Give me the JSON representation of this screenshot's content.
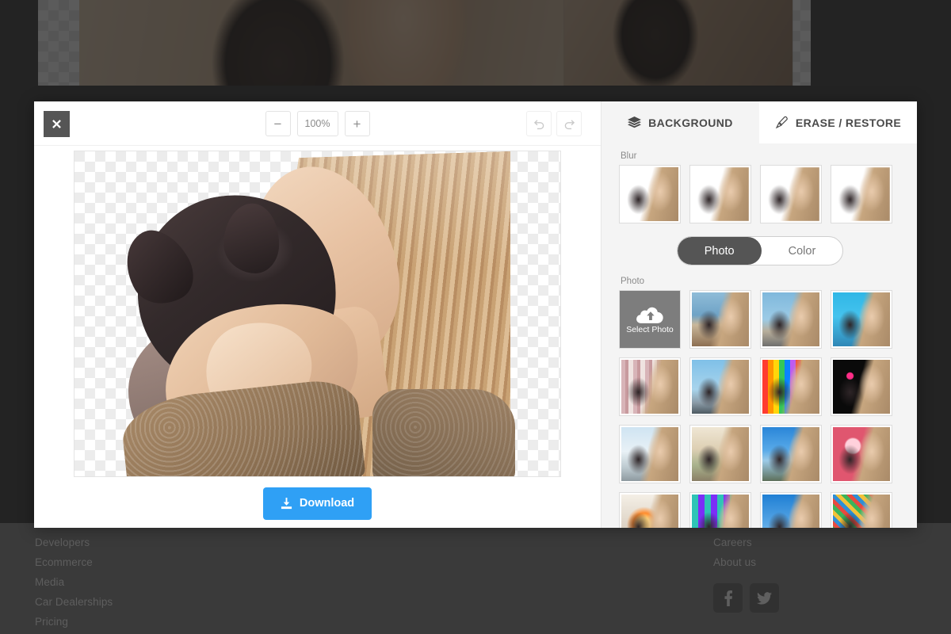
{
  "background_page": {
    "footer": {
      "left_links": [
        "Developers",
        "Ecommerce",
        "Media",
        "Car Dealerships",
        "Pricing"
      ],
      "right_links": [
        "Careers",
        "About us"
      ],
      "social": [
        {
          "name": "facebook-icon",
          "label": "Facebook"
        },
        {
          "name": "twitter-icon",
          "label": "Twitter"
        }
      ]
    }
  },
  "modal": {
    "toolbar": {
      "close_label": "✕",
      "zoom_out_label": "−",
      "zoom_value": "100%",
      "zoom_in_label": "+",
      "undo_label": "Undo",
      "redo_label": "Redo"
    },
    "canvas": {
      "transparency": "checkerboard",
      "alt": "Woman kissing a French bulldog puppy, background removed"
    },
    "download": {
      "label": "Download",
      "color": "#2fa0f5",
      "icon": "download-icon"
    }
  },
  "panel": {
    "tabs": [
      {
        "id": "background",
        "label": "BACKGROUND",
        "icon": "layers-icon",
        "active": false
      },
      {
        "id": "erase-restore",
        "label": "ERASE / RESTORE",
        "icon": "brush-icon",
        "active": true
      }
    ],
    "blur": {
      "label": "Blur",
      "items": [
        {
          "id": "blur-1",
          "strength": "0"
        },
        {
          "id": "blur-2",
          "strength": "1"
        },
        {
          "id": "blur-3",
          "strength": "2"
        },
        {
          "id": "blur-4",
          "strength": "3"
        }
      ]
    },
    "mode_toggle": {
      "options": [
        "Photo",
        "Color"
      ],
      "selected": "Photo"
    },
    "photo": {
      "label": "Photo",
      "select_photo": {
        "label": "Select Photo",
        "icon": "cloud-upload-icon"
      },
      "items": [
        {
          "id": "p1",
          "bg": "linear-gradient(180deg,#8fbcd8 0%,#6fa3c6 42%,#c9b79a 60%,#8d6f52 100%)"
        },
        {
          "id": "p2",
          "bg": "linear-gradient(180deg,#7fb8dc 0%,#9ccbe6 50%,#b8ae9b 72%,#6f6f6d 100%)"
        },
        {
          "id": "p3",
          "bg": "linear-gradient(180deg,#2fb7e6 0%,#45c3ee 45%,#2f87b6 100%)"
        },
        {
          "id": "p4",
          "bg": "repeating-linear-gradient(90deg,#d8b4b8 0 5px,#c89a9e 5px 9px,#efe2e0 9px 15px)"
        },
        {
          "id": "p5",
          "bg": "linear-gradient(180deg,#7fc0e8 0%,#a8d4ec 55%,#8a9aa6 80%,#4d5a62 100%)"
        },
        {
          "id": "p6",
          "bg": "repeating-linear-gradient(90deg,#ff3b30 0 7px,#ff9500 7px 14px,#ffd60a 14px 21px,#34c759 21px 28px,#0a84ff 28px 35px,#bf5af2 35px 42px)"
        },
        {
          "id": "p7",
          "bg": "radial-gradient(circle at 30% 30%, #ff2d87 0 4px, rgba(0,0,0,0) 5px), radial-gradient(circle at 70% 60%, #ff4fa3 0 4px, rgba(0,0,0,0) 5px), #0a0a0a"
        },
        {
          "id": "p8",
          "bg": "linear-gradient(180deg,#cfe4f2 0%,#e8f1f6 45%,#bcc9cf 75%,#8e9aa0 100%)"
        },
        {
          "id": "p9",
          "bg": "linear-gradient(180deg,#efe6d4 0%,#ded0b4 40%,#a9b38d 70%,#8a7f66 100%)"
        },
        {
          "id": "p10",
          "bg": "linear-gradient(180deg,#2a86d8 0%,#57a9e8 42%,#9ccbe8 62%,#5d6f5a 100%)"
        },
        {
          "id": "p11",
          "bg": "radial-gradient(circle at 35% 35%, #ffd1dc 0 9px, rgba(0,0,0,0) 11px), radial-gradient(circle at 70% 65%, #ff8fa8 0 10px, rgba(0,0,0,0) 12px), #e0566f"
        },
        {
          "id": "p12",
          "bg": "radial-gradient(circle at 40% 55%, #ffd37a 0 8px, #ff8c2e 14px, rgba(0,0,0,0) 22px), linear-gradient(180deg,#f4efe6,#cdbfae)"
        },
        {
          "id": "p13",
          "bg": "repeating-linear-gradient(90deg,#2ec4b6 0 8px,#7b2ff7 8px 16px), repeating-linear-gradient(0deg,rgba(255,255,255,.25) 0 4px, rgba(0,0,0,0) 4px 8px)"
        },
        {
          "id": "p14",
          "bg": "linear-gradient(180deg,#1f7fd4 0%,#5aa8e6 55%,#a8cde8 100%)"
        },
        {
          "id": "p15",
          "bg": "repeating-linear-gradient(45deg,#e84a3f 0 5px,#2f8fd6 5px 10px,#f2c23a 10px 15px,#3cb45a 15px 20px)"
        }
      ]
    }
  }
}
